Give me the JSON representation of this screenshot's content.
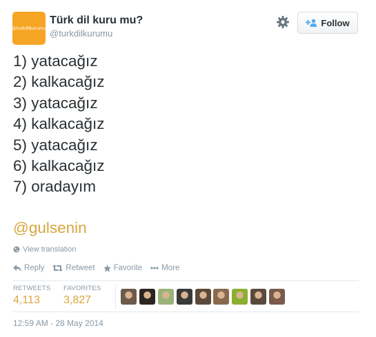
{
  "profile": {
    "name": "Türk dil kuru mu?",
    "handle": "@turkdilkurumu",
    "avatar_text": "@turkdilkurumu",
    "avatar_color": "#f6a524"
  },
  "header": {
    "follow_label": "Follow",
    "settings_icon": "gear-icon"
  },
  "tweet": {
    "lines": [
      "1) yatacağız",
      "2) kalkacağız",
      "3) yatacağız",
      "4) kalkacağız",
      "5) yatacağız",
      "6) kalkacağız",
      "7) oradayım"
    ],
    "mention": "@gulsenin",
    "mention_color": "#d8a63d"
  },
  "translate": {
    "label": "View translation"
  },
  "actions": {
    "reply": "Reply",
    "retweet": "Retweet",
    "favorite": "Favorite",
    "more": "More"
  },
  "stats": {
    "retweets_label": "RETWEETS",
    "retweets_value": "4,113",
    "favorites_label": "FAVORITES",
    "favorites_value": "3,827"
  },
  "favoriters": [
    {
      "color": "#6d5a4a"
    },
    {
      "color": "#2b2420"
    },
    {
      "color": "#9ab37a"
    },
    {
      "color": "#3a3a3a"
    },
    {
      "color": "#5b4a3a"
    },
    {
      "color": "#8a6a4f"
    },
    {
      "color": "#8cae2e"
    },
    {
      "color": "#5a4a3c"
    },
    {
      "color": "#7a5a4a"
    }
  ],
  "timestamp": "12:59 AM - 28 May 2014"
}
